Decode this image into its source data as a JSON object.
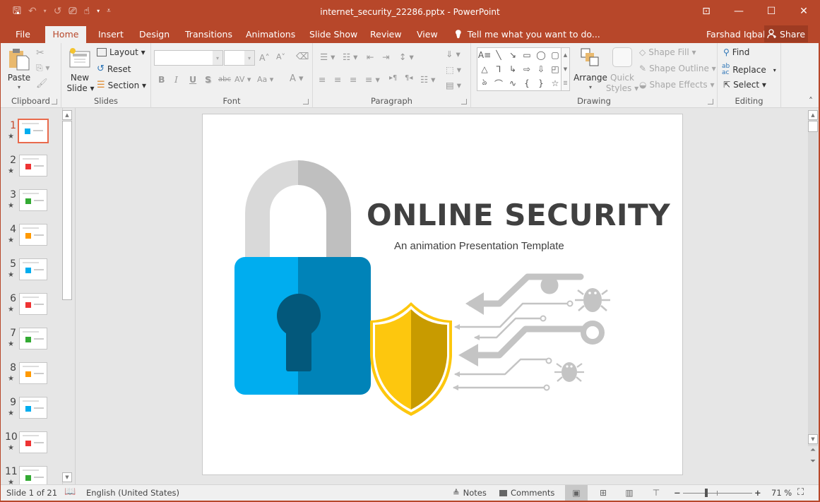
{
  "window": {
    "title": "internet_security_22286.pptx - PowerPoint",
    "controls": {
      "ribbon_display": "⊡",
      "minimize": "—",
      "maximize": "☐",
      "close": "✕"
    }
  },
  "qat": {
    "save": "🖫",
    "undo": "↶",
    "undo_dd": "▾",
    "redo": "↺",
    "present": "⎚",
    "touch": "☝",
    "touch_dd": "▾",
    "customize": "⩡"
  },
  "tabs": [
    {
      "label": "File"
    },
    {
      "label": "Home"
    },
    {
      "label": "Insert"
    },
    {
      "label": "Design"
    },
    {
      "label": "Transitions"
    },
    {
      "label": "Animations"
    },
    {
      "label": "Slide Show"
    },
    {
      "label": "Review"
    },
    {
      "label": "View"
    }
  ],
  "tell_me": {
    "icon": "💡",
    "placeholder": "Tell me what you want to do..."
  },
  "user": {
    "name": "Farshad Iqbal"
  },
  "share": {
    "label": "Share"
  },
  "ribbon": {
    "clipboard": {
      "label": "Clipboard",
      "paste": "Paste",
      "paste_dd": "▾"
    },
    "slides": {
      "label": "Slides",
      "new_slide_1": "New",
      "new_slide_2": "Slide ▾",
      "layout": "Layout ▾",
      "reset": "Reset",
      "section": "Section ▾"
    },
    "font": {
      "label": "Font",
      "font_name": "",
      "font_size": "",
      "grow": "A˄",
      "shrink": "A˅",
      "clear": "A⌫",
      "bold": "B",
      "italic": "I",
      "underline": "U",
      "shadow": "S",
      "strike": "abc",
      "spacing": "AV ▾",
      "case": "Aa ▾",
      "color": "A ▾"
    },
    "paragraph": {
      "label": "Paragraph"
    },
    "drawing": {
      "label": "Drawing",
      "shapes": [
        "A≡",
        "╲",
        "↘",
        "▭",
        "◯",
        "▢",
        "△",
        "⅂",
        "↳",
        "⇨",
        "⇩",
        "◰",
        "ঌ",
        "⌒",
        "∿",
        "{",
        "}",
        "☆"
      ],
      "arrange": "Arrange",
      "arrange_dd": "▾",
      "quick_styles_1": "Quick",
      "quick_styles_2": "Styles ▾",
      "shape_fill": "Shape Fill ▾",
      "shape_outline": "Shape Outline ▾",
      "shape_effects": "Shape Effects ▾"
    },
    "editing": {
      "label": "Editing",
      "find": "Find",
      "replace": "Replace",
      "replace_dd": "▾",
      "select": "Select ▾"
    },
    "collapse": "˄"
  },
  "slides_panel": {
    "selected": 1,
    "items": [
      {
        "num": "1",
        "star": "★"
      },
      {
        "num": "2",
        "star": "★"
      },
      {
        "num": "3",
        "star": "★"
      },
      {
        "num": "4",
        "star": "★"
      },
      {
        "num": "5",
        "star": "★"
      },
      {
        "num": "6",
        "star": "★"
      },
      {
        "num": "7",
        "star": "★"
      },
      {
        "num": "8",
        "star": "★"
      },
      {
        "num": "9",
        "star": "★"
      },
      {
        "num": "10",
        "star": "★"
      },
      {
        "num": "11",
        "star": "★"
      }
    ]
  },
  "slide": {
    "title": "ONLINE SECURITY",
    "subtitle": "An animation Presentation Template",
    "colors": {
      "shackle_light": "#d9d9d9",
      "shackle_dark": "#bfbfbf",
      "body_light": "#00adef",
      "body_dark": "#0083b8",
      "keyhole": "#03587b",
      "shield_light": "#fdc70e",
      "shield_dark": "#c89b00",
      "circuit": "#c4c4c4"
    }
  },
  "status": {
    "slide_of": "Slide 1 of 21",
    "language": "English (United States)",
    "notes": "Notes",
    "comments": "Comments",
    "zoom_percent": "71 %",
    "zoom_value": 71
  },
  "colors": {
    "accent": "#b7472a",
    "ribbon_bg": "#f0f0f0",
    "workspace_bg": "#e6e6e6"
  }
}
